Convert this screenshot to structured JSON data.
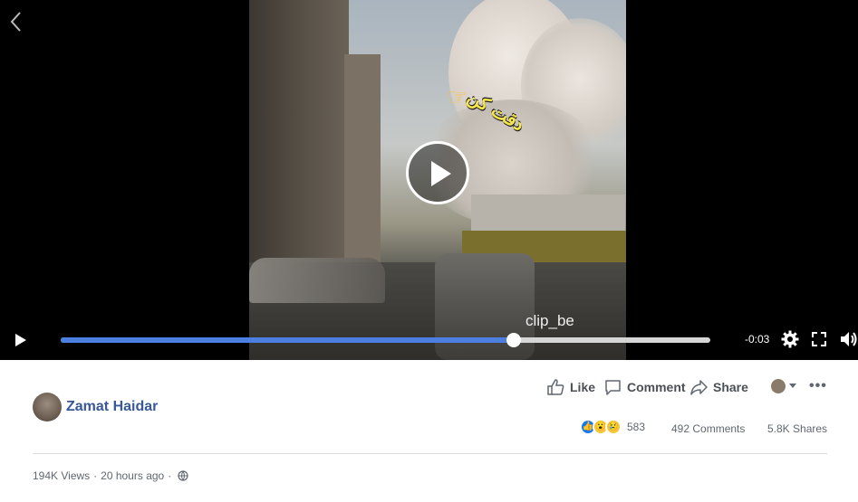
{
  "player": {
    "overlay_text": "دقت کن",
    "watermark": "clip_be",
    "time_remaining": "-0:03",
    "progress_fraction": 0.697
  },
  "post": {
    "author": "Zamat Haidar",
    "actions": {
      "like": "Like",
      "comment": "Comment",
      "share": "Share"
    },
    "reaction_count": "583",
    "comments": "492 Comments",
    "shares": "5.8K Shares",
    "views": "194K Views",
    "separator": "·",
    "time_ago": "20 hours ago"
  },
  "colors": {
    "accent": "#4b7fe0",
    "author_link": "#385898",
    "like_blue": "#1877f2"
  },
  "icons": [
    "back-chevron-icon",
    "play-icon",
    "gear-icon",
    "fullscreen-icon",
    "volume-icon",
    "like-icon",
    "comment-icon",
    "share-icon",
    "globe-icon",
    "more-icon"
  ]
}
